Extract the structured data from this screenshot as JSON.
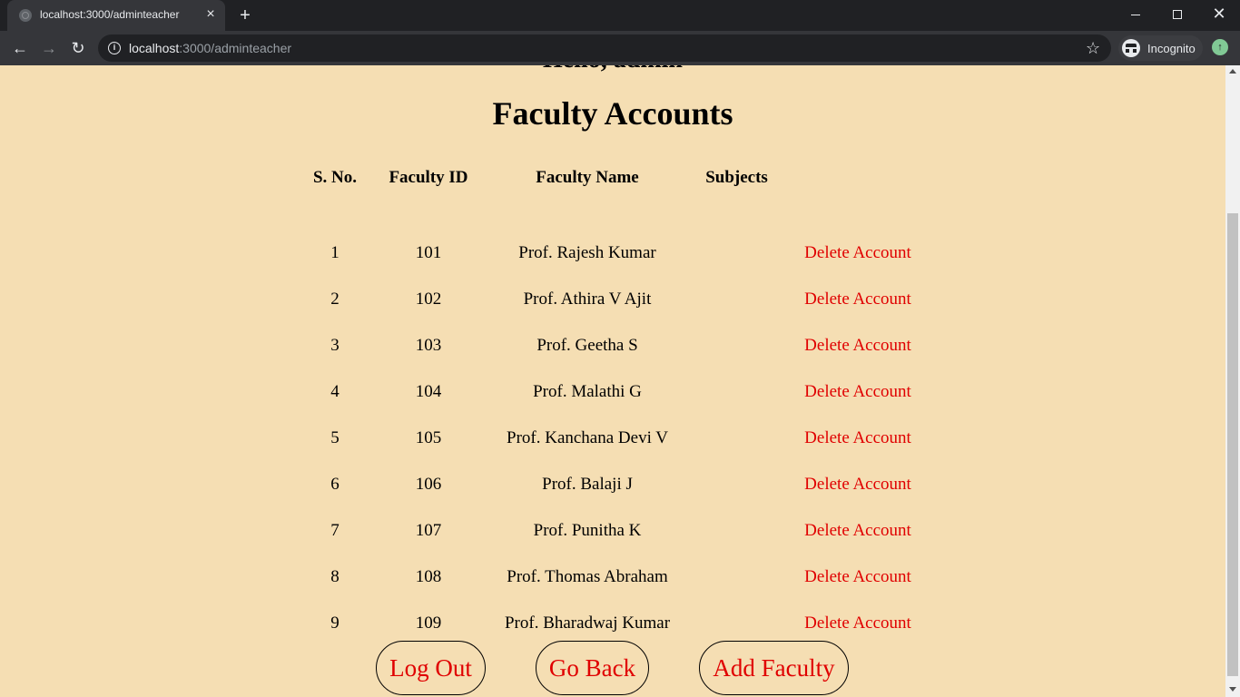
{
  "browser": {
    "tab_title": "localhost:3000/adminteacher",
    "url_host": "localhost",
    "url_path": ":3000/adminteacher",
    "incognito_label": "Incognito"
  },
  "page": {
    "greeting": "Hello, admin",
    "title": "Faculty Accounts",
    "table": {
      "headers": [
        "S. No.",
        "Faculty ID",
        "Faculty Name",
        "Subjects",
        ""
      ],
      "rows": [
        {
          "sno": "1",
          "id": "101",
          "name": "Prof. Rajesh Kumar",
          "subjects": "",
          "action": "Delete Account"
        },
        {
          "sno": "2",
          "id": "102",
          "name": "Prof. Athira V Ajit",
          "subjects": "",
          "action": "Delete Account"
        },
        {
          "sno": "3",
          "id": "103",
          "name": "Prof. Geetha S",
          "subjects": "",
          "action": "Delete Account"
        },
        {
          "sno": "4",
          "id": "104",
          "name": "Prof. Malathi G",
          "subjects": "",
          "action": "Delete Account"
        },
        {
          "sno": "5",
          "id": "105",
          "name": "Prof. Kanchana Devi V",
          "subjects": "",
          "action": "Delete Account"
        },
        {
          "sno": "6",
          "id": "106",
          "name": "Prof. Balaji J",
          "subjects": "",
          "action": "Delete Account"
        },
        {
          "sno": "7",
          "id": "107",
          "name": "Prof. Punitha K",
          "subjects": "",
          "action": "Delete Account"
        },
        {
          "sno": "8",
          "id": "108",
          "name": "Prof. Thomas Abraham",
          "subjects": "",
          "action": "Delete Account"
        },
        {
          "sno": "9",
          "id": "109",
          "name": "Prof. Bharadwaj Kumar",
          "subjects": "",
          "action": "Delete Account"
        }
      ]
    },
    "buttons": {
      "logout": "Log Out",
      "back": "Go Back",
      "add": "Add Faculty"
    }
  },
  "colors": {
    "page_background": "#f5deb3",
    "action_text": "#e00000"
  }
}
